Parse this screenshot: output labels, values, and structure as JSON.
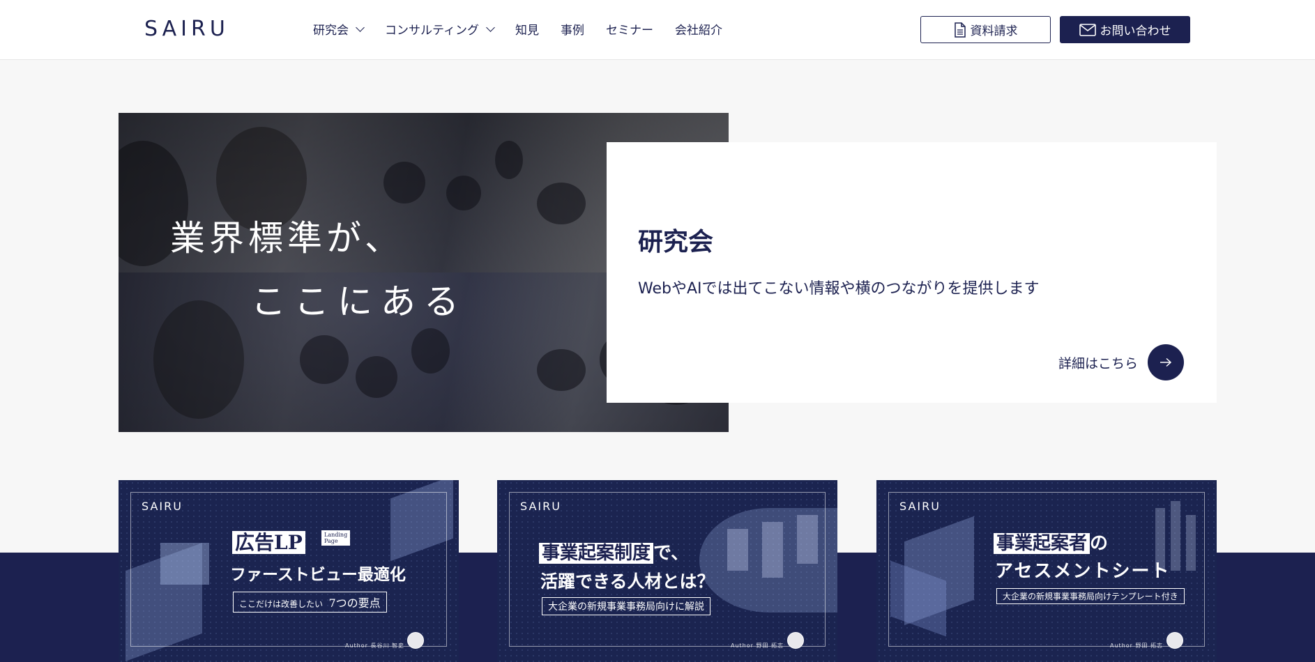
{
  "header": {
    "logo": "SAIRU",
    "nav": [
      {
        "label": "研究会",
        "has_dropdown": true
      },
      {
        "label": "コンサルティング",
        "has_dropdown": true
      },
      {
        "label": "知見",
        "has_dropdown": false
      },
      {
        "label": "事例",
        "has_dropdown": false
      },
      {
        "label": "セミナー",
        "has_dropdown": false
      },
      {
        "label": "会社紹介",
        "has_dropdown": false
      }
    ],
    "doc_button": "資料請求",
    "contact_button": "お問い合わせ"
  },
  "hero": {
    "image_line1": "業界標準が、",
    "image_line2": "ここにある",
    "title": "研究会",
    "description": "WebやAIでは出てこない情報や横のつながりを提供します",
    "detail_link": "詳細はこちら"
  },
  "cards": [
    {
      "brand": "SAIRU",
      "title_highlight": "広告LP",
      "lp_tag_line1": "Landing",
      "lp_tag_line2": "Page",
      "title_line2": "ファーストビュー最適化",
      "subtitle_prefix": "ここだけは改善したい",
      "subtitle_main": "7つの要点",
      "author": "Author 長谷川 智史"
    },
    {
      "brand": "SAIRU",
      "title_highlight": "事業起案制度",
      "title_suffix": "で、",
      "title_line2": "活躍できる人材とは？",
      "subtitle": "大企業の新規事業事務局向けに解説",
      "author": "Author 野田 拓志"
    },
    {
      "brand": "SAIRU",
      "title_highlight": "事業起案者",
      "title_suffix": "の",
      "title_line2": "アセスメントシート",
      "subtitle": "大企業の新規事業事務局向けテンプレート付き",
      "author": "Author 野田 拓志"
    }
  ],
  "colors": {
    "navy": "#1c2150",
    "background": "#f7f7f7",
    "white": "#ffffff"
  }
}
